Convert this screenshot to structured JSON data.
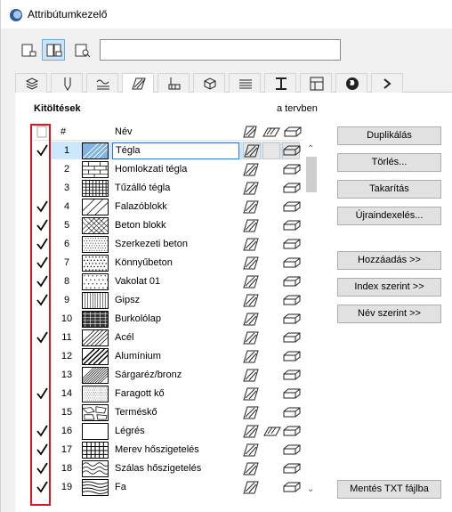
{
  "window": {
    "title": "Attribútumkezelő"
  },
  "toolbar": {
    "view_buttons": [
      {
        "icon": "single-view-icon",
        "active": false
      },
      {
        "icon": "dual-view-icon",
        "active": true
      },
      {
        "icon": "preview-view-icon",
        "active": false
      }
    ],
    "search_value": ""
  },
  "tabs": [
    {
      "icon": "layers-icon",
      "active": false
    },
    {
      "icon": "pen-icon",
      "active": false
    },
    {
      "icon": "linetype-icon",
      "active": false
    },
    {
      "icon": "fill-icon",
      "active": true
    },
    {
      "icon": "composite-icon",
      "active": false
    },
    {
      "icon": "building-material-icon",
      "active": false
    },
    {
      "icon": "surface-icon",
      "active": false
    },
    {
      "icon": "profile-icon",
      "active": false
    },
    {
      "icon": "zone-icon",
      "active": false
    },
    {
      "icon": "globe-icon",
      "active": false
    },
    {
      "icon": "overflow-icon",
      "active": false
    }
  ],
  "section": {
    "title": "Kitöltések",
    "in_plan_label": "a tervben"
  },
  "table": {
    "headers": {
      "num": "#",
      "name": "Név"
    },
    "rows": [
      {
        "num": "1",
        "name": "Tégla",
        "checked": true,
        "pattern": "tegla",
        "selected": true,
        "dual": false
      },
      {
        "num": "2",
        "name": "Homlokzati tégla",
        "checked": false,
        "pattern": "brick",
        "dual": false
      },
      {
        "num": "3",
        "name": "Tűzálló tégla",
        "checked": false,
        "pattern": "grid",
        "dual": false
      },
      {
        "num": "4",
        "name": "Falazóblokk",
        "checked": true,
        "pattern": "diag-wide",
        "dual": false
      },
      {
        "num": "5",
        "name": "Beton blokk",
        "checked": true,
        "pattern": "cross",
        "dual": false
      },
      {
        "num": "6",
        "name": "Szerkezeti beton",
        "checked": true,
        "pattern": "dots-fine",
        "dual": false
      },
      {
        "num": "7",
        "name": "Könnyűbeton",
        "checked": true,
        "pattern": "dots",
        "dual": false
      },
      {
        "num": "8",
        "name": "Vakolat 01",
        "checked": true,
        "pattern": "dots-sparse",
        "dual": false
      },
      {
        "num": "9",
        "name": "Gipsz",
        "checked": true,
        "pattern": "vlines",
        "dual": false
      },
      {
        "num": "10",
        "name": "Burkolólap",
        "checked": false,
        "pattern": "dense-cross",
        "dual": false
      },
      {
        "num": "11",
        "name": "Acél",
        "checked": true,
        "pattern": "diag-steel",
        "dual": false
      },
      {
        "num": "12",
        "name": "Alumínium",
        "checked": false,
        "pattern": "diag-bold",
        "dual": false
      },
      {
        "num": "13",
        "name": "Sárgaréz/bronz",
        "checked": false,
        "pattern": "diag-dense",
        "dual": false
      },
      {
        "num": "14",
        "name": "Faragott kő",
        "checked": true,
        "pattern": "stipple",
        "dual": false
      },
      {
        "num": "15",
        "name": "Terméskő",
        "checked": false,
        "pattern": "stone",
        "dual": false
      },
      {
        "num": "16",
        "name": "Légrés",
        "checked": true,
        "pattern": "empty",
        "dual": true
      },
      {
        "num": "17",
        "name": "Merev hőszigetelés",
        "checked": true,
        "pattern": "grid-bold",
        "dual": false
      },
      {
        "num": "18",
        "name": "Szálas hőszigetelés",
        "checked": true,
        "pattern": "waves",
        "dual": false
      },
      {
        "num": "19",
        "name": "Fa",
        "checked": true,
        "pattern": "wood",
        "dual": false
      }
    ]
  },
  "buttons": {
    "duplicate": "Duplikálás",
    "delete": "Törlés...",
    "purge": "Takarítás",
    "reindex": "Újraindexelés...",
    "add": "Hozzáadás >>",
    "by_index": "Index szerint >>",
    "by_name": "Név szerint >>",
    "save_txt": "Mentés TXT fájlba"
  },
  "colors": {
    "highlight_box": "#e0141e",
    "selection": "#cce8ff",
    "active_view": "#cce4f7"
  }
}
